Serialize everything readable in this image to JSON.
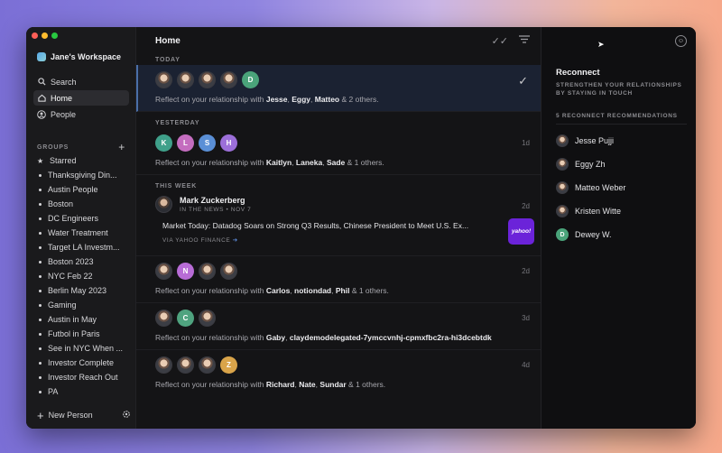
{
  "sidebar": {
    "workspace": "Jane's Workspace",
    "nav": [
      {
        "label": "Search",
        "icon": "search-icon"
      },
      {
        "label": "Home",
        "icon": "home-icon",
        "active": true
      },
      {
        "label": "People",
        "icon": "people-icon"
      }
    ],
    "groups_label": "GROUPS",
    "groups": [
      {
        "label": "Starred",
        "icon": "star-icon"
      },
      {
        "label": "Thanksgiving Din..."
      },
      {
        "label": "Austin People"
      },
      {
        "label": "Boston"
      },
      {
        "label": "DC Engineers"
      },
      {
        "label": "Water Treatment"
      },
      {
        "label": "Target LA Investm..."
      },
      {
        "label": "Boston 2023"
      },
      {
        "label": "NYC Feb 22"
      },
      {
        "label": "Berlin May 2023"
      },
      {
        "label": "Gaming"
      },
      {
        "label": "Austin in May"
      },
      {
        "label": "Futbol in Paris"
      },
      {
        "label": "See in NYC When ..."
      },
      {
        "label": "Investor Complete"
      },
      {
        "label": "Investor Reach Out"
      },
      {
        "label": "PA"
      }
    ],
    "new_person": "New Person"
  },
  "main": {
    "title": "Home",
    "sections": {
      "today": "TODAY",
      "yesterday": "YESTERDAY",
      "this_week": "THIS WEEK"
    },
    "entries": [
      {
        "prefix": "Reflect on your relationship with ",
        "names": [
          "Jesse",
          "Eggy",
          "Matteo"
        ],
        "suffix": " & 2 others.",
        "time": ""
      },
      {
        "prefix": "Reflect on your relationship with ",
        "names": [
          "Kaitlyn",
          "Laneka",
          "Sade"
        ],
        "suffix": " & 1 others.",
        "time": "1d"
      },
      {
        "prefix": "Reflect on your relationship with ",
        "names": [
          "Carlos",
          "notiondad",
          "Phil"
        ],
        "suffix": " & 1 others.",
        "time": "2d"
      },
      {
        "prefix": "Reflect on your relationship with ",
        "names": [
          "Gaby",
          "claydemodelegated-7ymccvnhj-cpmxfbc2ra-hi3dcebtdk"
        ],
        "suffix": "",
        "time": "3d"
      },
      {
        "prefix": "Reflect on your relationship with ",
        "names": [
          "Richard",
          "Nate",
          "Sundar"
        ],
        "suffix": " & 1 others.",
        "time": "4d"
      }
    ],
    "news": {
      "name": "Mark Zuckerberg",
      "sub": "IN THE NEWS • NOV 7",
      "headline": "Market Today: Datadog Soars on Strong Q3 Results, Chinese President to Meet U.S. Ex...",
      "via": "VIA YAHOO FINANCE",
      "via_arrow": "➔",
      "thumb": "yahoo!",
      "time": "2d"
    },
    "avatar_letters": {
      "today": [
        "",
        "",
        "",
        "",
        "D"
      ],
      "yesterday": [
        "K",
        "L",
        "S",
        "H"
      ],
      "carlos": [
        "",
        "N",
        "",
        ""
      ],
      "gaby": [
        "",
        "C",
        ""
      ],
      "richard": [
        "",
        "",
        "",
        "Z"
      ]
    }
  },
  "reconnect": {
    "title": "Reconnect",
    "subtitle": "STRENGTHEN YOUR RELATIONSHIPS BY STAYING IN TOUCH",
    "count_label": "5 RECONNECT RECOMMENDATIONS",
    "people": [
      {
        "name": "Jesse Pujji",
        "letter": ""
      },
      {
        "name": "Eggy Zh",
        "letter": ""
      },
      {
        "name": "Matteo Weber",
        "letter": ""
      },
      {
        "name": "Kristen Witte",
        "letter": ""
      },
      {
        "name": "Dewey W.",
        "letter": "D"
      }
    ]
  },
  "colors": {
    "accent": "#4a6fa8",
    "traffic_red": "#ff5f57",
    "traffic_yellow": "#febc2e",
    "traffic_green": "#28c840",
    "yahoo": "#6b23d9"
  }
}
